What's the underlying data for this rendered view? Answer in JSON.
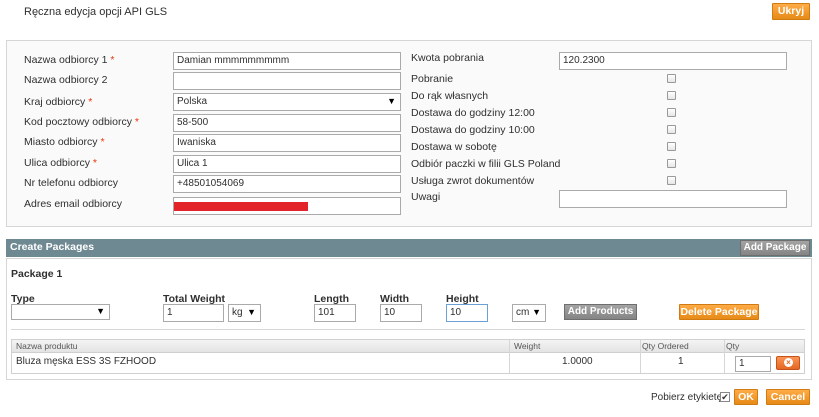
{
  "header": {
    "title": "Ręczna edycja opcji API GLS",
    "hide_label": "Ukryj"
  },
  "recipient": {
    "name1": {
      "label": "Nazwa odbiorcy 1",
      "value": "Damian mmmmmmmmm"
    },
    "name2": {
      "label": "Nazwa odbiorcy 2",
      "value": ""
    },
    "country": {
      "label": "Kraj odbiorcy",
      "value": "Polska"
    },
    "postcode": {
      "label": "Kod pocztowy odbiorcy",
      "value": "58-500"
    },
    "city": {
      "label": "Miasto odbiorcy",
      "value": "Iwaniska"
    },
    "street": {
      "label": "Ulica odbiorcy",
      "value": "Ulica 1"
    },
    "phone": {
      "label": "Nr telefonu odbiorcy",
      "value": "+48501054069"
    },
    "email": {
      "label": "Adres email odbiorcy",
      "value": ""
    },
    "required_mark": "*"
  },
  "options": {
    "cod_label": "Kwota pobrania",
    "cod_value": "120.2300",
    "checks": [
      {
        "label": "Pobranie",
        "checked": false
      },
      {
        "label": "Do rąk własnych",
        "checked": false
      },
      {
        "label": "Dostawa do godziny 12:00",
        "checked": false
      },
      {
        "label": "Dostawa do godziny 10:00",
        "checked": false
      },
      {
        "label": "Dostawa w sobotę",
        "checked": false
      },
      {
        "label": "Odbiór paczki w filii GLS Poland",
        "checked": false
      },
      {
        "label": "Usługa zwrot dokumentów",
        "checked": false
      }
    ],
    "notes_label": "Uwagi",
    "notes_value": ""
  },
  "packages": {
    "section_title": "Create Packages",
    "add_package_label": "Add Package",
    "package_title": "Package 1",
    "type_label": "Type",
    "type_value": "",
    "total_weight_label": "Total Weight",
    "total_weight_value": "1",
    "weight_unit": "kg",
    "length_label": "Length",
    "length_value": "101",
    "width_label": "Width",
    "width_value": "10",
    "height_label": "Height",
    "height_value": "10",
    "dim_unit": "cm",
    "add_products_label": "Add Products",
    "delete_package_label": "Delete Package",
    "grid": {
      "headers": [
        "Nazwa produktu",
        "Weight",
        "Qty Ordered",
        "Qty"
      ],
      "rows": [
        {
          "name": "Bluza męska ESS 3S FZHOOD",
          "weight": "1.0000",
          "qty_ordered": "1",
          "qty": "1"
        }
      ]
    }
  },
  "footer": {
    "label_print": "Pobierz etykietę",
    "label_checked": true,
    "ok_label": "OK",
    "cancel_label": "Cancel"
  },
  "colors": {
    "accent": "#eb8a1c",
    "section_bar": "#6f8992",
    "required": "#eb340a",
    "redacted": "#e3232a"
  }
}
